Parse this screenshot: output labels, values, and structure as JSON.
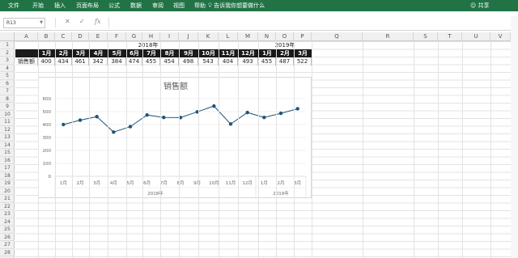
{
  "ribbon": {
    "tabs": [
      "文件",
      "开始",
      "插入",
      "页面布局",
      "公式",
      "数据",
      "审阅",
      "视图",
      "帮助"
    ],
    "tell_me": "告诉我你想要做什么",
    "share": "共享"
  },
  "formula_bar": {
    "name_box": "R13",
    "cancel": "✕",
    "enter": "✓",
    "fx": "fx",
    "formula": ""
  },
  "columns": [
    "A",
    "B",
    "C",
    "D",
    "E",
    "F",
    "G",
    "H",
    "I",
    "J",
    "K",
    "L",
    "M",
    "N",
    "O",
    "P",
    "Q",
    "R",
    "S",
    "T",
    "U",
    "V"
  ],
  "rows": [
    "1",
    "2",
    "3",
    "4",
    "5",
    "6",
    "7",
    "8",
    "9",
    "10",
    "11",
    "12",
    "13",
    "14",
    "15",
    "16",
    "17",
    "18",
    "19",
    "20",
    "21",
    "22",
    "23",
    "24",
    "25",
    "26",
    "27",
    "28"
  ],
  "table": {
    "year_2018": "2018年",
    "year_2019": "2019年",
    "months": [
      "1月",
      "2月",
      "3月",
      "4月",
      "5月",
      "6月",
      "7月",
      "8月",
      "9月",
      "10月",
      "11月",
      "12月",
      "1月",
      "2月",
      "3月"
    ],
    "row_label": "销售额",
    "values": [
      400,
      434,
      461,
      342,
      384,
      474,
      455,
      454,
      498,
      543,
      404,
      493,
      455,
      487,
      522
    ]
  },
  "chart_data": {
    "type": "line",
    "title": "销售额",
    "categories": [
      "1月",
      "2月",
      "3月",
      "4月",
      "5月",
      "6月",
      "7月",
      "8月",
      "9月",
      "10月",
      "11月",
      "12月",
      "1月",
      "2月",
      "3月"
    ],
    "groups": [
      "2018年",
      "2019年"
    ],
    "series": [
      {
        "values": [
          400,
          434,
          461,
          342,
          384,
          474,
          455,
          454,
          498,
          543,
          404,
          493,
          455,
          487,
          522
        ]
      }
    ],
    "yticks": [
      "0",
      "100",
      "200",
      "300",
      "400",
      "500",
      "600"
    ],
    "ylim": [
      0,
      600
    ],
    "grid": true,
    "color": "#1f5478"
  }
}
